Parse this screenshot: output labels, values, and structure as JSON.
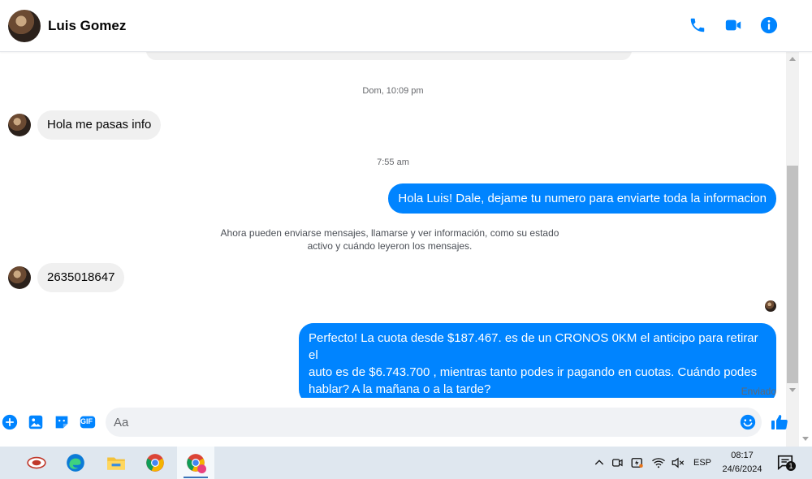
{
  "header": {
    "contact_name": "Luis Gomez",
    "icons": [
      "phone-icon",
      "video-camera-icon",
      "info-icon"
    ]
  },
  "thread": {
    "timestamp_1": "Dom, 10:09 pm",
    "msg_in_1": "Hola me pasas info",
    "timestamp_2": "7:55 am",
    "msg_out_1": "Hola Luis! Dale, dejame tu numero para enviarte toda la informacion",
    "notice_line1": "Ahora pueden enviarse mensajes, llamarse y ver información, como su estado",
    "notice_line2": "activo y cuándo leyeron los mensajes.",
    "msg_in_2": "2635018647",
    "msg_out_2_line1": "Perfecto! La cuota desde $187.467. es de un CRONOS 0KM el anticipo para retirar el",
    "msg_out_2_line2": "auto es de $6.743.700 , mientras tanto podes ir pagando en cuotas. Cuándo podes",
    "msg_out_2_line3": "hablar? A la mañana o a la tarde?",
    "status": "Enviado"
  },
  "composer": {
    "placeholder": "Aa",
    "gif_label": "GIF"
  },
  "taskbar": {
    "lang": "ESP",
    "time": "08:17",
    "date": "24/6/2024",
    "notification_count": "1"
  },
  "colors": {
    "accent": "#0084ff",
    "bubble_in": "#f0f0f0",
    "taskbar": "#dfe7ef"
  }
}
